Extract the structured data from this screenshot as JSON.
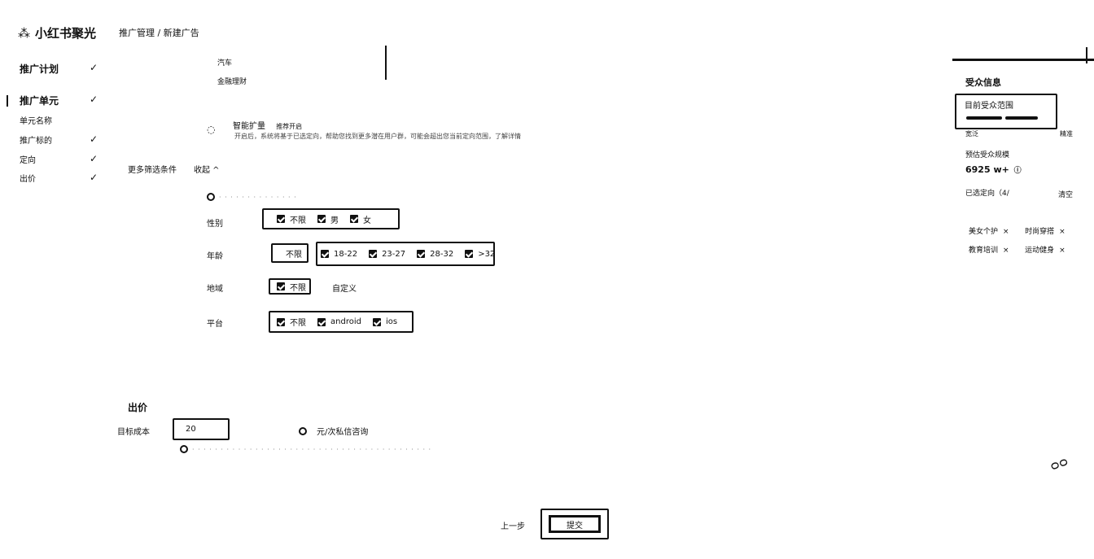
{
  "brand": {
    "logo_icon": "sparkle-icon",
    "name": "小红书聚光"
  },
  "breadcrumb": "推广管理 / 新建广告",
  "sidebar": {
    "items": [
      {
        "label": "推广计划",
        "check": "✓"
      },
      {
        "label": "推广单元",
        "check": "✓"
      },
      {
        "label": "单元名称",
        "check": ""
      },
      {
        "label": "推广标的",
        "check": "✓"
      },
      {
        "label": "定向",
        "check": "✓"
      },
      {
        "label": "出价",
        "check": "✓"
      }
    ]
  },
  "industry_list": {
    "items": [
      "汽车",
      "金融理财"
    ]
  },
  "smart_expand": {
    "label": "智能扩量",
    "tag": "推荐开启",
    "desc": "开启后，系统将基于已选定向，帮助您找到更多潜在用户群，可能会超出您当前定向范围，了解详情"
  },
  "more_filters": {
    "label": "更多筛选条件",
    "toggle": "收起 ^"
  },
  "targeting": {
    "gender": {
      "label": "性别",
      "options": [
        "不限",
        "男",
        "女"
      ]
    },
    "age": {
      "label": "年龄",
      "unlimited": "不限",
      "options": [
        "18-22",
        "23-27",
        "28-32",
        ">32"
      ]
    },
    "region": {
      "label": "地域",
      "unlimited": "不限",
      "custom": "自定义"
    },
    "platform": {
      "label": "平台",
      "options": [
        "不限",
        "android",
        "ios"
      ]
    }
  },
  "bid": {
    "section_title": "出价",
    "target_cost_label": "目标成本",
    "target_cost_value": "20",
    "unit": "元/次私信咨询"
  },
  "footer": {
    "prev": "上一步",
    "submit": "提交"
  },
  "audience": {
    "title": "受众信息",
    "scope_label": "目前受众范围",
    "scope_left": "宽泛",
    "scope_right": "精准",
    "estimate_label": "预估受众规模",
    "estimate_value": "6925 w+",
    "selected_label": "已选定向（4/",
    "clear": "清空",
    "tags": [
      "美女个护",
      "时尚穿搭",
      "教育培训",
      "运动健身"
    ]
  }
}
